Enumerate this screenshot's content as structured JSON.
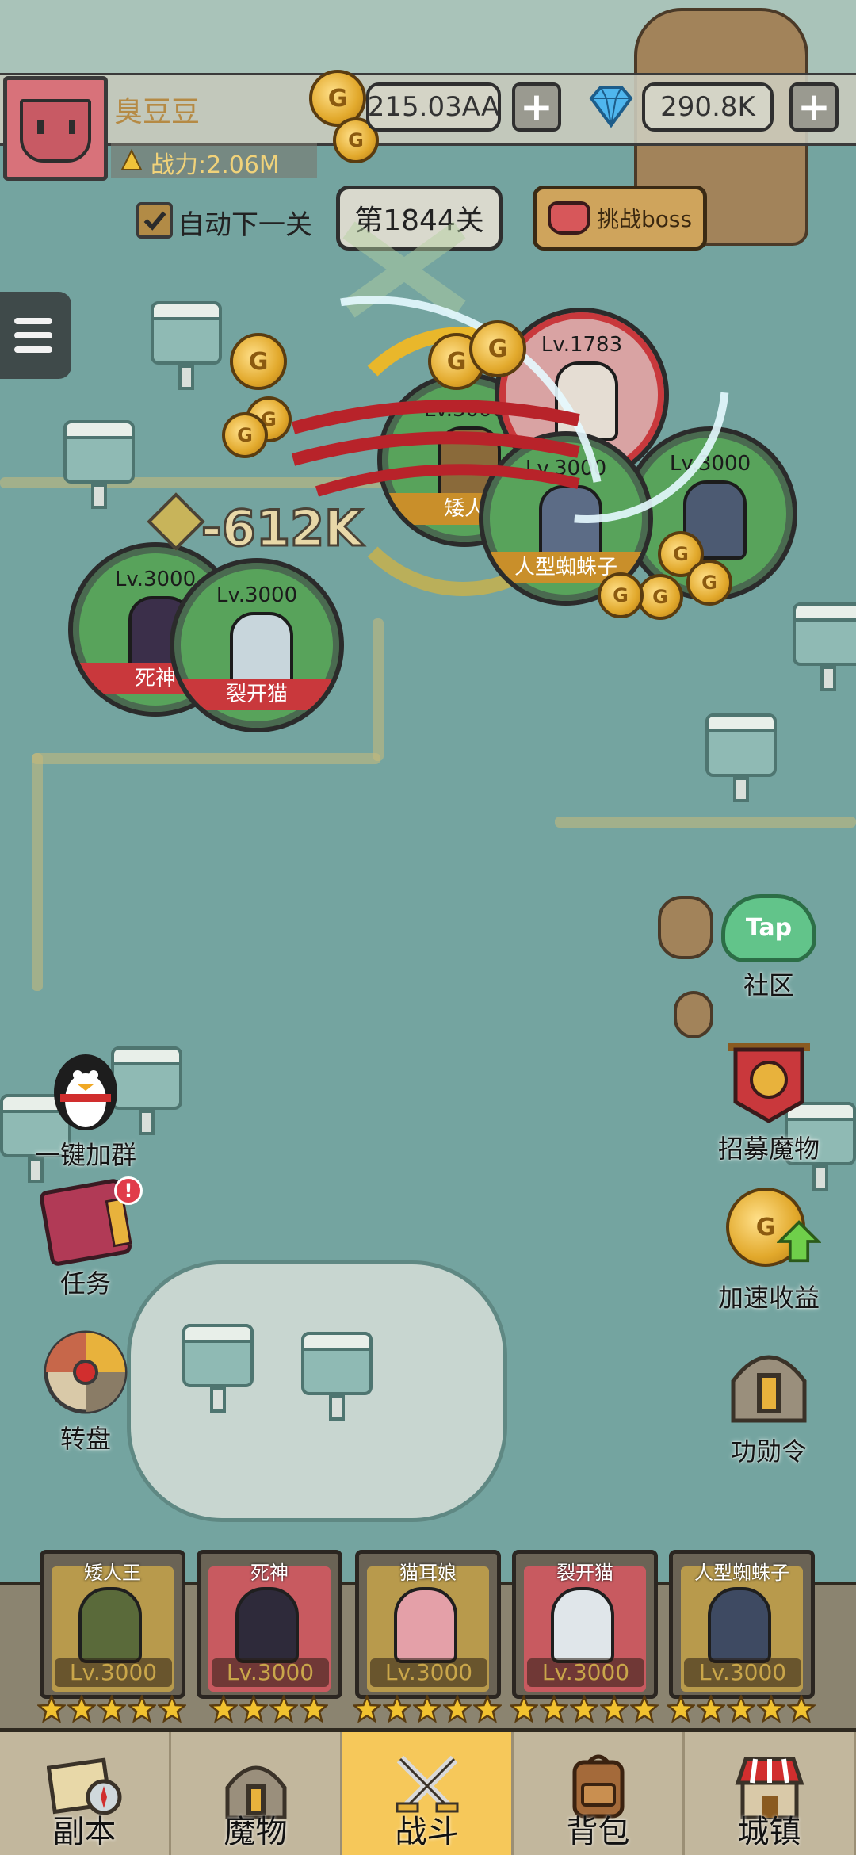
{
  "player": {
    "name": "臭豆豆",
    "power_label": "战力:2.06M"
  },
  "currency": {
    "gold": "215.03AA",
    "gems": "290.8K",
    "add_gold_label": "+",
    "add_gems_label": "+"
  },
  "stage": {
    "auto_next_label": "自动下一关",
    "auto_next_checked": true,
    "current": "第1844关",
    "boss_label": "挑战boss"
  },
  "battle": {
    "damage_text": "-612K",
    "units": [
      {
        "level": "Lv.3000",
        "name": "死神"
      },
      {
        "level": "Lv.3000",
        "name": "裂开猫"
      },
      {
        "level": "Lv.3000",
        "name": "矮人"
      },
      {
        "level": "Lv.1783",
        "name": ""
      },
      {
        "level": "Lv.3000",
        "name": "人型蜘蛛子"
      },
      {
        "level": "Lv.3000",
        "name": ""
      }
    ]
  },
  "side_left": [
    {
      "label": "一键加群",
      "icon": "penguin-icon"
    },
    {
      "label": "任务",
      "icon": "book-icon",
      "badge": "!"
    },
    {
      "label": "转盘",
      "icon": "wheel-icon"
    }
  ],
  "side_right": [
    {
      "label": "社区",
      "icon": "tap-cloud-icon",
      "icon_text": "Tap"
    },
    {
      "label": "招募魔物",
      "icon": "recruit-banner-icon"
    },
    {
      "label": "加速收益",
      "icon": "coin-speedup-icon"
    },
    {
      "label": "功勋令",
      "icon": "helmet-icon"
    }
  ],
  "heroes": [
    {
      "name": "矮人王",
      "level": "Lv.3000",
      "stars": 5,
      "color": "#b89a4c"
    },
    {
      "name": "死神",
      "level": "Lv.3000",
      "stars": 4,
      "color": "#c85a60"
    },
    {
      "name": "猫耳娘",
      "level": "Lv.3000",
      "stars": 5,
      "color": "#b89a4c"
    },
    {
      "name": "裂开猫",
      "level": "Lv.3000",
      "stars": 5,
      "color": "#c85a60"
    },
    {
      "name": "人型蜘蛛子",
      "level": "Lv.3000",
      "stars": 5,
      "color": "#b89a4c"
    }
  ],
  "nav": [
    {
      "label": "副本",
      "icon": "map-compass-icon"
    },
    {
      "label": "魔物",
      "icon": "monster-helmet-icon"
    },
    {
      "label": "战斗",
      "icon": "crossed-swords-icon",
      "active": true
    },
    {
      "label": "背包",
      "icon": "backpack-icon"
    },
    {
      "label": "城镇",
      "icon": "shop-icon"
    }
  ],
  "colors": {
    "map": "#74a4a0",
    "active_tab": "#f6c85a",
    "gold": "#e2a92c",
    "ally_ring": "#58a35b",
    "enemy_ring": "#c9383c"
  }
}
